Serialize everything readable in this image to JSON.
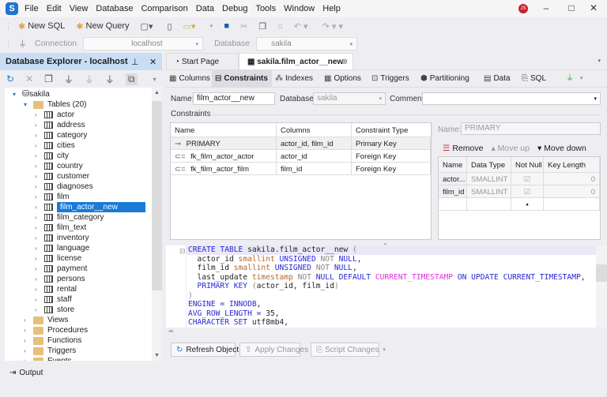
{
  "app": {
    "logo": "S",
    "menu": [
      "File",
      "Edit",
      "View",
      "Database",
      "Comparison",
      "Data",
      "Debug",
      "Tools",
      "Window",
      "Help"
    ],
    "avatar": "JS"
  },
  "toolbar": {
    "new_sql": "New SQL",
    "new_query": "New Query"
  },
  "connection_bar": {
    "connection_label": "Connection",
    "connection_value": "localhost",
    "database_label": "Database",
    "database_value": "sakila"
  },
  "explorer": {
    "title": "Database Explorer - localhost",
    "db": "sakila",
    "tables_folder": "Tables (20)",
    "tables": [
      "actor",
      "address",
      "category",
      "cities",
      "city",
      "country",
      "customer",
      "diagnoses",
      "film",
      "film_actor__new",
      "film_category",
      "film_text",
      "inventory",
      "language",
      "license",
      "payment",
      "persons",
      "rental",
      "staff",
      "store"
    ],
    "selected": "film_actor__new",
    "folders": [
      "Views",
      "Procedures",
      "Functions",
      "Triggers",
      "Events"
    ]
  },
  "output": {
    "label": "Output"
  },
  "doc_tabs": [
    "Start Page",
    "sakila.film_actor__new"
  ],
  "sub_tabs": [
    "Columns",
    "Constraints",
    "Indexes",
    "Options",
    "Triggers",
    "Partitioning",
    "Data",
    "SQL"
  ],
  "active_sub_tab": "Constraints",
  "form": {
    "name_label": "Name:",
    "name_value": "film_actor__new",
    "database_label": "Database:",
    "database_value": "sakila",
    "comment_label": "Comment:",
    "comment_value": ""
  },
  "constraints": {
    "section_label": "Constraints",
    "headers": [
      "Name",
      "Columns",
      "Constraint Type"
    ],
    "rows": [
      {
        "name": "PRIMARY",
        "columns": "actor_id, film_id",
        "type": "Primary Key",
        "icon": "key-icon"
      },
      {
        "name": "fk_film_actor_actor",
        "columns": "actor_id",
        "type": "Foreign Key",
        "icon": "foreign-key-icon"
      },
      {
        "name": "fk_film_actor_film",
        "columns": "film_id",
        "type": "Foreign Key",
        "icon": "foreign-key-icon"
      }
    ]
  },
  "detail": {
    "name_label": "Name:",
    "name_value": "PRIMARY",
    "remove": "Remove",
    "move_up": "Move up",
    "move_down": "Move down",
    "headers": [
      "Name",
      "Data Type",
      "Not Null",
      "Key Length"
    ],
    "rows": [
      {
        "name": "actor...",
        "type": "SMALLINT",
        "not_null": true,
        "key_length": "0"
      },
      {
        "name": "film_id",
        "type": "SMALLINT",
        "not_null": true,
        "key_length": "0"
      }
    ]
  },
  "sql": [
    [
      [
        "CREATE TABLE ",
        "kw"
      ],
      [
        "sakila.film_actor__new ",
        "pl"
      ],
      [
        "(",
        "gr"
      ]
    ],
    [
      [
        "  actor_id ",
        "pl"
      ],
      [
        "smallint ",
        "ty"
      ],
      [
        "UNSIGNED ",
        "kw"
      ],
      [
        "NOT ",
        "gr"
      ],
      [
        "NULL",
        "kw"
      ],
      [
        ",",
        "pl"
      ]
    ],
    [
      [
        "  film_id ",
        "pl"
      ],
      [
        "smallint ",
        "ty"
      ],
      [
        "UNSIGNED ",
        "kw"
      ],
      [
        "NOT ",
        "gr"
      ],
      [
        "NULL",
        "kw"
      ],
      [
        ",",
        "pl"
      ]
    ],
    [
      [
        "  last_update ",
        "pl"
      ],
      [
        "timestamp ",
        "ty"
      ],
      [
        "NOT ",
        "gr"
      ],
      [
        "NULL DEFAULT ",
        "kw"
      ],
      [
        "CURRENT_TIMESTAMP ",
        "fn"
      ],
      [
        "ON UPDATE CURRENT_TIMESTAMP",
        "kw"
      ],
      [
        ",",
        "pl"
      ]
    ],
    [
      [
        "  PRIMARY KEY ",
        "kw"
      ],
      [
        "(",
        "gr"
      ],
      [
        "actor_id, film_id",
        "pl"
      ],
      [
        ")",
        "gr"
      ]
    ],
    [
      [
        ")",
        "gr"
      ]
    ],
    [
      [
        "ENGINE = INNODB",
        "kw"
      ],
      [
        ",",
        "pl"
      ]
    ],
    [
      [
        "AVG_ROW_LENGTH = ",
        "kw"
      ],
      [
        "35,",
        "pl"
      ]
    ],
    [
      [
        "CHARACTER SET ",
        "kw"
      ],
      [
        "utf8mb4,",
        "pl"
      ]
    ]
  ],
  "buttons": {
    "refresh": "Refresh Object",
    "apply": "Apply Changes",
    "script": "Script Changes"
  }
}
